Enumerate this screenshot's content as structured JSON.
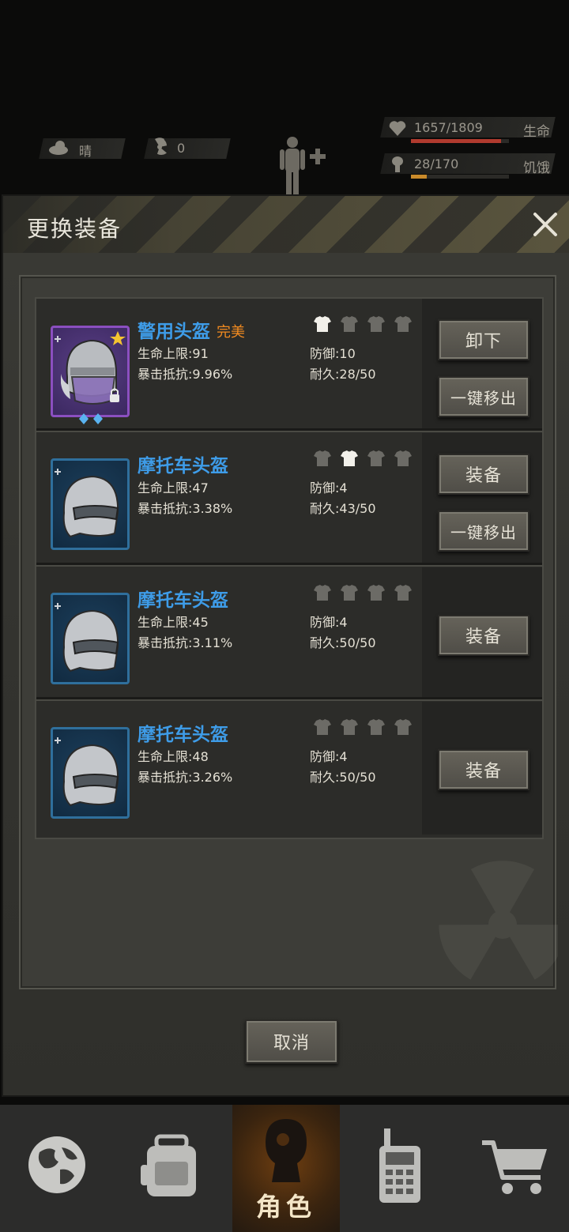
{
  "status": {
    "weather_label": "晴",
    "radiation_value": "0",
    "health_value": "1657/1809",
    "health_label": "生命",
    "health_fraction": 0.916,
    "hunger_value": "28/170",
    "hunger_label": "饥饿",
    "hunger_fraction": 0.165
  },
  "modal": {
    "title": "更换装备",
    "cancel_label": "取消"
  },
  "items": [
    {
      "name": "警用头盔",
      "quality": "完美",
      "life_label": "生命上限:91",
      "crit_label": "暴击抵抗:9.96%",
      "defense_label": "防御:10",
      "durability_label": "耐久:28/50",
      "primary_button": "卸下",
      "secondary_button": "一键移出",
      "icon": "police-helmet-icon",
      "active_slot": 1
    },
    {
      "name": "摩托车头盔",
      "life_label": "生命上限:47",
      "crit_label": "暴击抵抗:3.38%",
      "defense_label": "防御:4",
      "durability_label": "耐久:43/50",
      "primary_button": "装备",
      "secondary_button": "一键移出",
      "icon": "motorcycle-helmet-icon",
      "active_slot": 2
    },
    {
      "name": "摩托车头盔",
      "life_label": "生命上限:45",
      "crit_label": "暴击抵抗:3.11%",
      "defense_label": "防御:4",
      "durability_label": "耐久:50/50",
      "primary_button": "装备",
      "icon": "motorcycle-helmet-icon",
      "active_slot": 0
    },
    {
      "name": "摩托车头盔",
      "life_label": "生命上限:48",
      "crit_label": "暴击抵抗:3.26%",
      "defense_label": "防御:4",
      "durability_label": "耐久:50/50",
      "primary_button": "装备",
      "icon": "motorcycle-helmet-icon",
      "active_slot": 0
    }
  ],
  "nav": {
    "tabs": [
      {
        "icon": "globe-icon"
      },
      {
        "icon": "backpack-icon"
      },
      {
        "icon": "character-icon",
        "label": "角色",
        "active": true
      },
      {
        "icon": "radio-icon"
      },
      {
        "icon": "cart-icon"
      }
    ]
  },
  "colors": {
    "name_blue": "#3e9ce8",
    "quality_orange": "#f08a20",
    "health_red": "#c0392b",
    "hunger_orange": "#c98a2a"
  }
}
